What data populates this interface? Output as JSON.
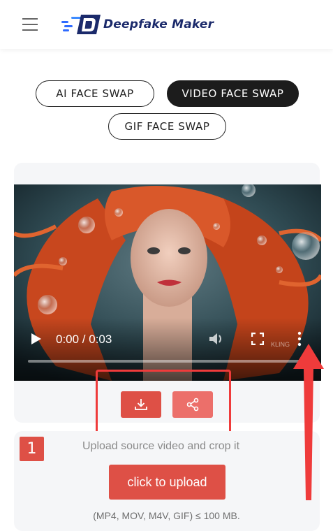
{
  "header": {
    "logo_text": "Deepfake Maker",
    "menu_icon": "hamburger-menu-icon"
  },
  "tabs": [
    {
      "label": "AI FACE SWAP",
      "active": false
    },
    {
      "label": "VIDEO FACE SWAP",
      "active": true
    },
    {
      "label": "GIF FACE SWAP",
      "active": false
    }
  ],
  "video": {
    "time": "0:00 / 0:03",
    "progress": 0.0,
    "watermark": "KLING",
    "play_icon": "play-icon",
    "volume_icon": "volume-icon",
    "fullscreen_icon": "fullscreen-icon",
    "more_icon": "more-vertical-icon"
  },
  "actions": {
    "download_icon": "download-icon",
    "share_icon": "share-icon"
  },
  "upload": {
    "step_number": "1",
    "step_label": "Upload source video and crop it",
    "button_label": "click to upload",
    "formats_note": "(MP4, MOV, M4V, GIF) ≤ 100 MB."
  },
  "colors": {
    "accent": "#de5046",
    "accent_light": "#ec6f6a",
    "active_tab": "#1c1c1c",
    "annotation": "#ef3b3b",
    "logo_blue": "#1b2a6b"
  }
}
